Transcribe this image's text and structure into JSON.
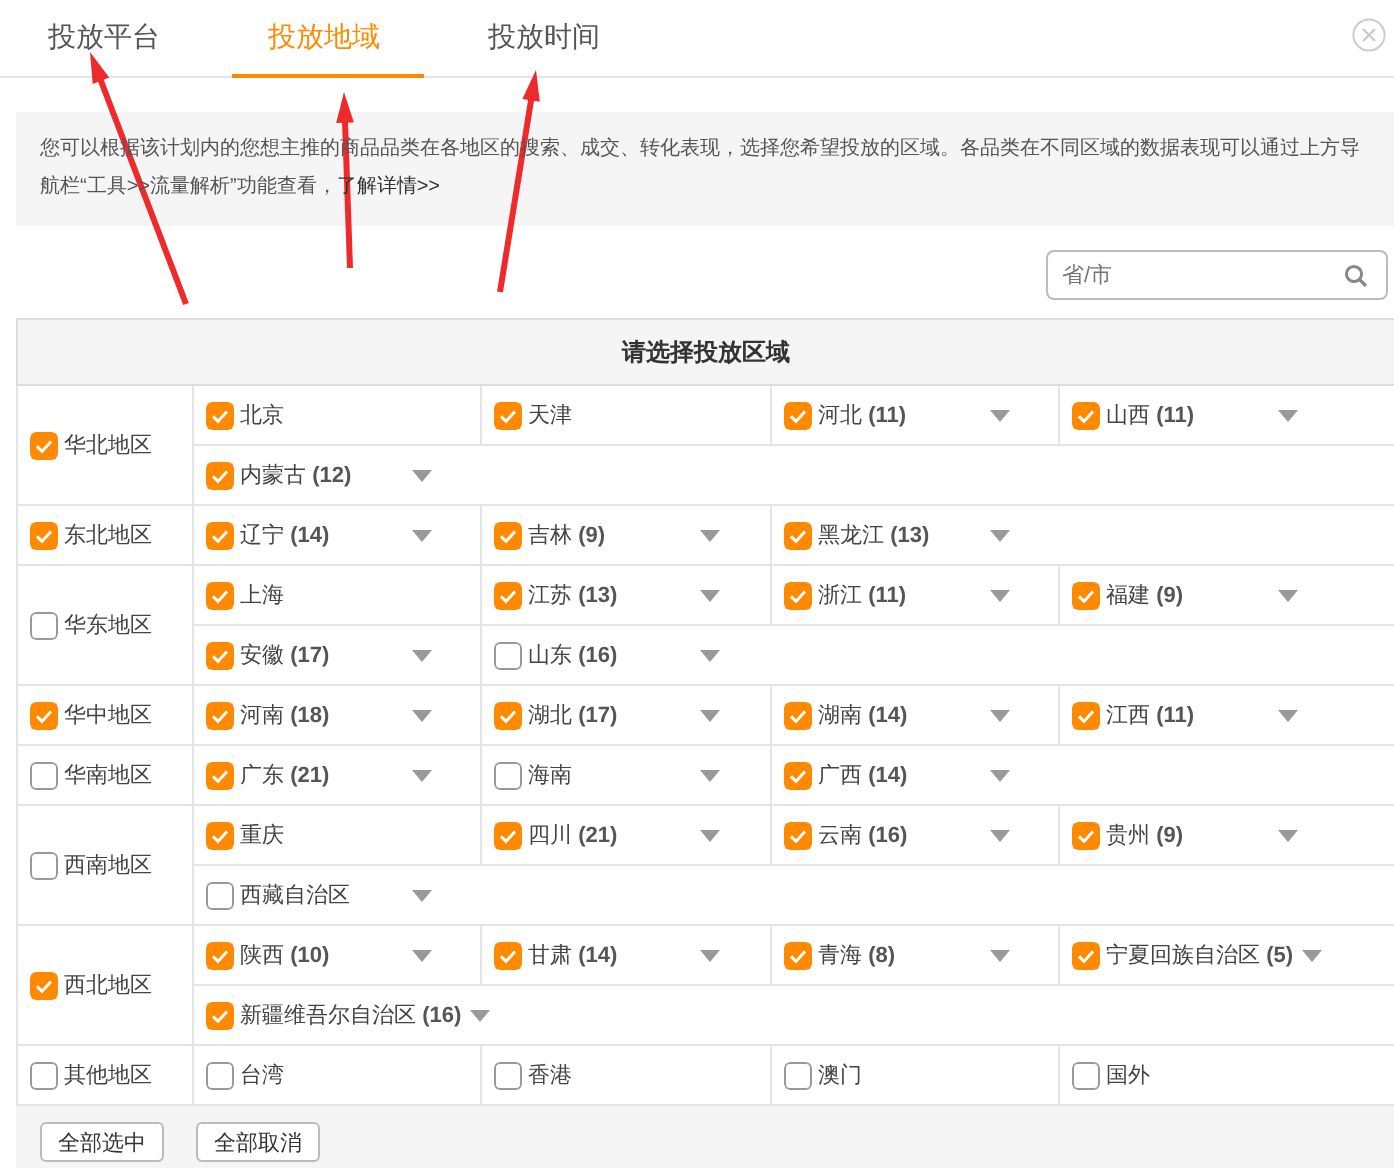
{
  "tabs": [
    {
      "label": "投放平台",
      "selected": false
    },
    {
      "label": "投放地域",
      "selected": true
    },
    {
      "label": "投放时间",
      "selected": false
    }
  ],
  "notice": {
    "text": "您可以根据该计划内的您想主推的商品品类在各地区的搜索、成交、转化表现，选择您希望投放的区域。各品类在不同区域的数据表现可以通过上方导航栏“工具>>流量解析”功能查看，",
    "link": "了解详情>>"
  },
  "search": {
    "placeholder": "省/市"
  },
  "table": {
    "title": "请选择投放区域",
    "regions": [
      {
        "name": "华北地区",
        "checked": true,
        "provinces": [
          {
            "name": "北京",
            "checked": true,
            "dropdown": false
          },
          {
            "name": "天津",
            "checked": true,
            "dropdown": false
          },
          {
            "name": "河北",
            "count": "(11)",
            "checked": true,
            "dropdown": true
          },
          {
            "name": "山西",
            "count": "(11)",
            "checked": true,
            "dropdown": true
          },
          {
            "name": "内蒙古",
            "count": "(12)",
            "checked": true,
            "dropdown": true
          }
        ]
      },
      {
        "name": "东北地区",
        "checked": true,
        "provinces": [
          {
            "name": "辽宁",
            "count": "(14)",
            "checked": true,
            "dropdown": true
          },
          {
            "name": "吉林",
            "count": "(9)",
            "checked": true,
            "dropdown": true
          },
          {
            "name": "黑龙江",
            "count": "(13)",
            "checked": true,
            "dropdown": true
          }
        ]
      },
      {
        "name": "华东地区",
        "checked": false,
        "provinces": [
          {
            "name": "上海",
            "checked": true,
            "dropdown": false
          },
          {
            "name": "江苏",
            "count": "(13)",
            "checked": true,
            "dropdown": true
          },
          {
            "name": "浙江",
            "count": "(11)",
            "checked": true,
            "dropdown": true
          },
          {
            "name": "福建",
            "count": "(9)",
            "checked": true,
            "dropdown": true
          },
          {
            "name": "安徽",
            "count": "(17)",
            "checked": true,
            "dropdown": true
          },
          {
            "name": "山东",
            "count": "(16)",
            "checked": false,
            "dropdown": true
          }
        ]
      },
      {
        "name": "华中地区",
        "checked": true,
        "provinces": [
          {
            "name": "河南",
            "count": "(18)",
            "checked": true,
            "dropdown": true
          },
          {
            "name": "湖北",
            "count": "(17)",
            "checked": true,
            "dropdown": true
          },
          {
            "name": "湖南",
            "count": "(14)",
            "checked": true,
            "dropdown": true
          },
          {
            "name": "江西",
            "count": "(11)",
            "checked": true,
            "dropdown": true
          }
        ]
      },
      {
        "name": "华南地区",
        "checked": false,
        "provinces": [
          {
            "name": "广东",
            "count": "(21)",
            "checked": true,
            "dropdown": true
          },
          {
            "name": "海南",
            "checked": false,
            "dropdown": true
          },
          {
            "name": "广西",
            "count": "(14)",
            "checked": true,
            "dropdown": true
          }
        ]
      },
      {
        "name": "西南地区",
        "checked": false,
        "provinces": [
          {
            "name": "重庆",
            "checked": true,
            "dropdown": false
          },
          {
            "name": "四川",
            "count": "(21)",
            "checked": true,
            "dropdown": true
          },
          {
            "name": "云南",
            "count": "(16)",
            "checked": true,
            "dropdown": true
          },
          {
            "name": "贵州",
            "count": "(9)",
            "checked": true,
            "dropdown": true
          },
          {
            "name": "西藏自治区",
            "checked": false,
            "dropdown": true
          }
        ]
      },
      {
        "name": "西北地区",
        "checked": true,
        "provinces": [
          {
            "name": "陕西",
            "count": "(10)",
            "checked": true,
            "dropdown": true
          },
          {
            "name": "甘肃",
            "count": "(14)",
            "checked": true,
            "dropdown": true
          },
          {
            "name": "青海",
            "count": "(8)",
            "checked": true,
            "dropdown": true
          },
          {
            "name": "宁夏回族自治区",
            "count": "(5)",
            "checked": true,
            "dropdown": true
          },
          {
            "name": "新疆维吾尔自治区",
            "count": "(16)",
            "checked": true,
            "dropdown": true
          }
        ]
      },
      {
        "name": "其他地区",
        "checked": false,
        "provinces": [
          {
            "name": "台湾",
            "checked": false,
            "dropdown": false
          },
          {
            "name": "香港",
            "checked": false,
            "dropdown": false
          },
          {
            "name": "澳门",
            "checked": false,
            "dropdown": false
          },
          {
            "name": "国外",
            "checked": false,
            "dropdown": false
          }
        ]
      }
    ]
  },
  "buttons": [
    "全部选中",
    "全部取消"
  ]
}
